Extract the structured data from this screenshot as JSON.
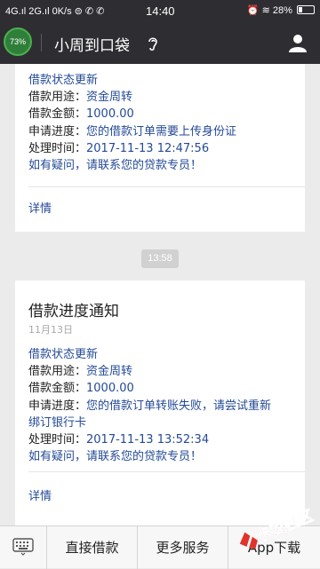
{
  "status_bar": {
    "left": "4G.ıl 2G.ıl 0K/s ⊜ ✆ ✆",
    "time": "14:40",
    "battery": "28%"
  },
  "header": {
    "badge": "73%",
    "title": "小周到口袋"
  },
  "cards": [
    {
      "lines": [
        {
          "label": "借款状态更新",
          "value": ""
        },
        {
          "label": "借款用途：",
          "value": "资金周转"
        },
        {
          "label": "借款金额：",
          "value": "1000.00"
        },
        {
          "label": "申请进度：",
          "value": "您的借款订单需要上传身份证"
        },
        {
          "label": "处理时间：",
          "value": "2017-11-13 12:47:56"
        },
        {
          "label": "如有疑问，请联系您的贷款专员！",
          "value": ""
        }
      ],
      "detail": "详情"
    },
    {
      "title": "借款进度通知",
      "date": "11月13日",
      "lines": [
        {
          "label": "借款状态更新",
          "value": ""
        },
        {
          "label": "借款用途：",
          "value": "资金周转"
        },
        {
          "label": "借款金额：",
          "value": "1000.00"
        },
        {
          "label": "申请进度：",
          "value": "您的借款订单转账失败，请尝试重新"
        },
        {
          "label": "绑订银行卡",
          "value": ""
        },
        {
          "label": "处理时间：",
          "value": "2017-11-13 13:52:34"
        },
        {
          "label": "如有疑问，请联系您的贷款专员！",
          "value": ""
        }
      ],
      "detail": "详情"
    }
  ],
  "timestamp": "13:58",
  "menu": [
    "直接借款",
    "更多服务",
    "App下载"
  ],
  "watermark": "卡农社区",
  "colors": {
    "bar": "#2e2e32",
    "link": "#234a96",
    "background": "#ebebeb"
  }
}
